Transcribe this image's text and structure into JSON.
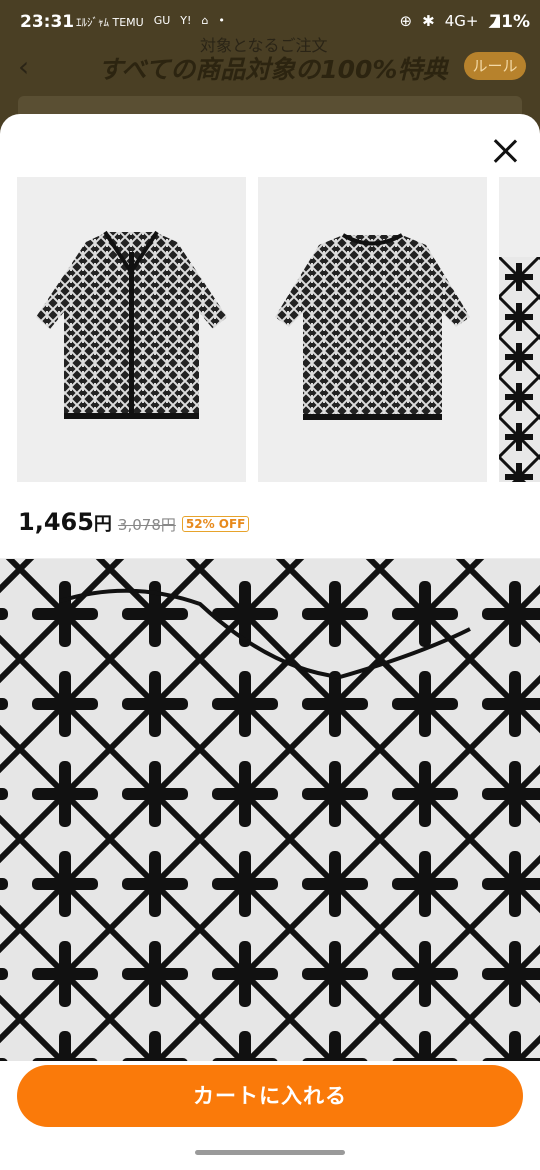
{
  "status_bar": {
    "time": "23:31",
    "apps": [
      "ｴﾙｼﾞｬﾑ TEMU",
      "GU",
      "Y!",
      "house-icon",
      "•"
    ],
    "network": "4G+",
    "battery": "71%"
  },
  "background_page": {
    "subtitle": "対象となるご注文",
    "title": "すべての商品対象の100%特典",
    "rule_button": "ルール"
  },
  "sheet": {
    "price": "1,465",
    "price_unit": "円",
    "original_price": "3,078円",
    "discount_badge": "52% OFF",
    "cart_button": "カートに入れる"
  },
  "colors": {
    "accent_orange": "#fa7a0a",
    "badge_orange": "#e78a1d",
    "overlay_brown": "#4a3f24"
  }
}
